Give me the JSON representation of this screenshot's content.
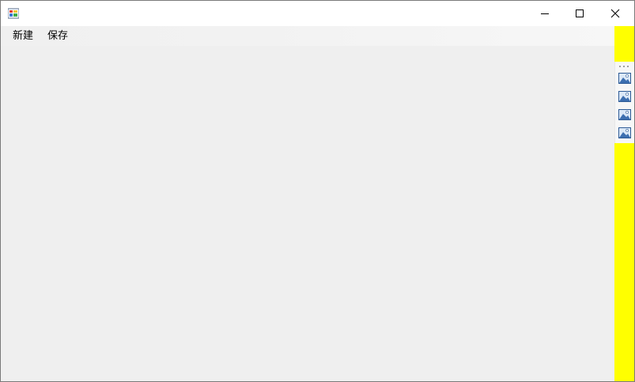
{
  "window": {
    "title": "",
    "controls": {
      "minimize_icon": "minimize-icon",
      "maximize_icon": "maximize-icon",
      "close_icon": "close-icon"
    }
  },
  "menubar": {
    "items": [
      {
        "label": "新建"
      },
      {
        "label": "保存"
      }
    ]
  },
  "toolstrip": {
    "buttons": [
      {
        "icon": "image-icon"
      },
      {
        "icon": "image-icon"
      },
      {
        "icon": "image-icon"
      },
      {
        "icon": "image-icon"
      }
    ]
  },
  "colors": {
    "side_strip": "#ffff00",
    "client_area": "#efefef",
    "titlebar": "#ffffff"
  }
}
